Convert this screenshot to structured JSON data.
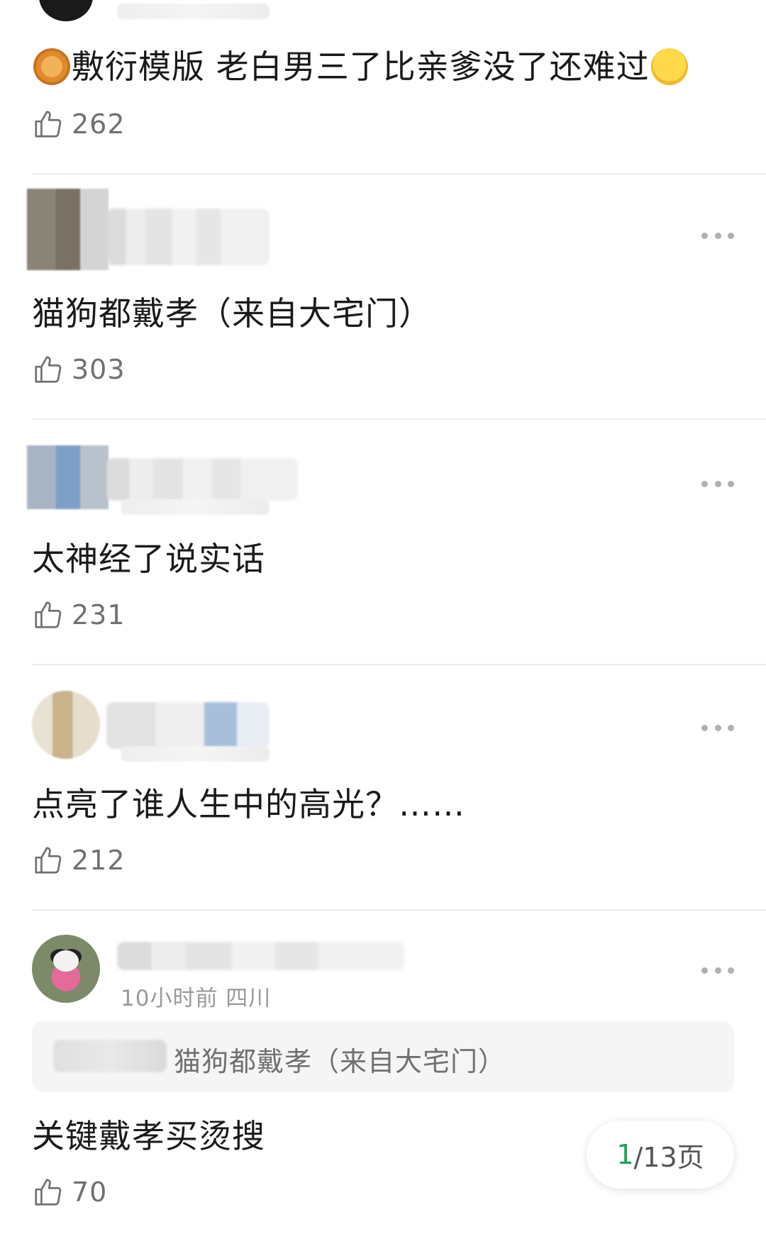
{
  "comments": [
    {
      "text": "敷衍模版 老白男三了比亲爹没了还难过",
      "emoji_lead": "moon-cake",
      "emoji_trail": "grinning-sweat",
      "likes": "262"
    },
    {
      "text": "猫狗都戴孝（来自大宅门）",
      "likes": "303"
    },
    {
      "text": "太神经了说实话",
      "likes": "231"
    },
    {
      "text": "点亮了谁人生中的高光？……",
      "likes": "212"
    },
    {
      "meta": "10小时前 四川",
      "quote": "猫狗都戴孝（来自大宅门）",
      "text": "关键戴孝买烫搜",
      "likes": "70"
    }
  ],
  "pager": {
    "current": "1",
    "total_suffix": "/13页"
  },
  "colors": {
    "accent": "#1aa05a",
    "muted": "#9a9a9a"
  }
}
